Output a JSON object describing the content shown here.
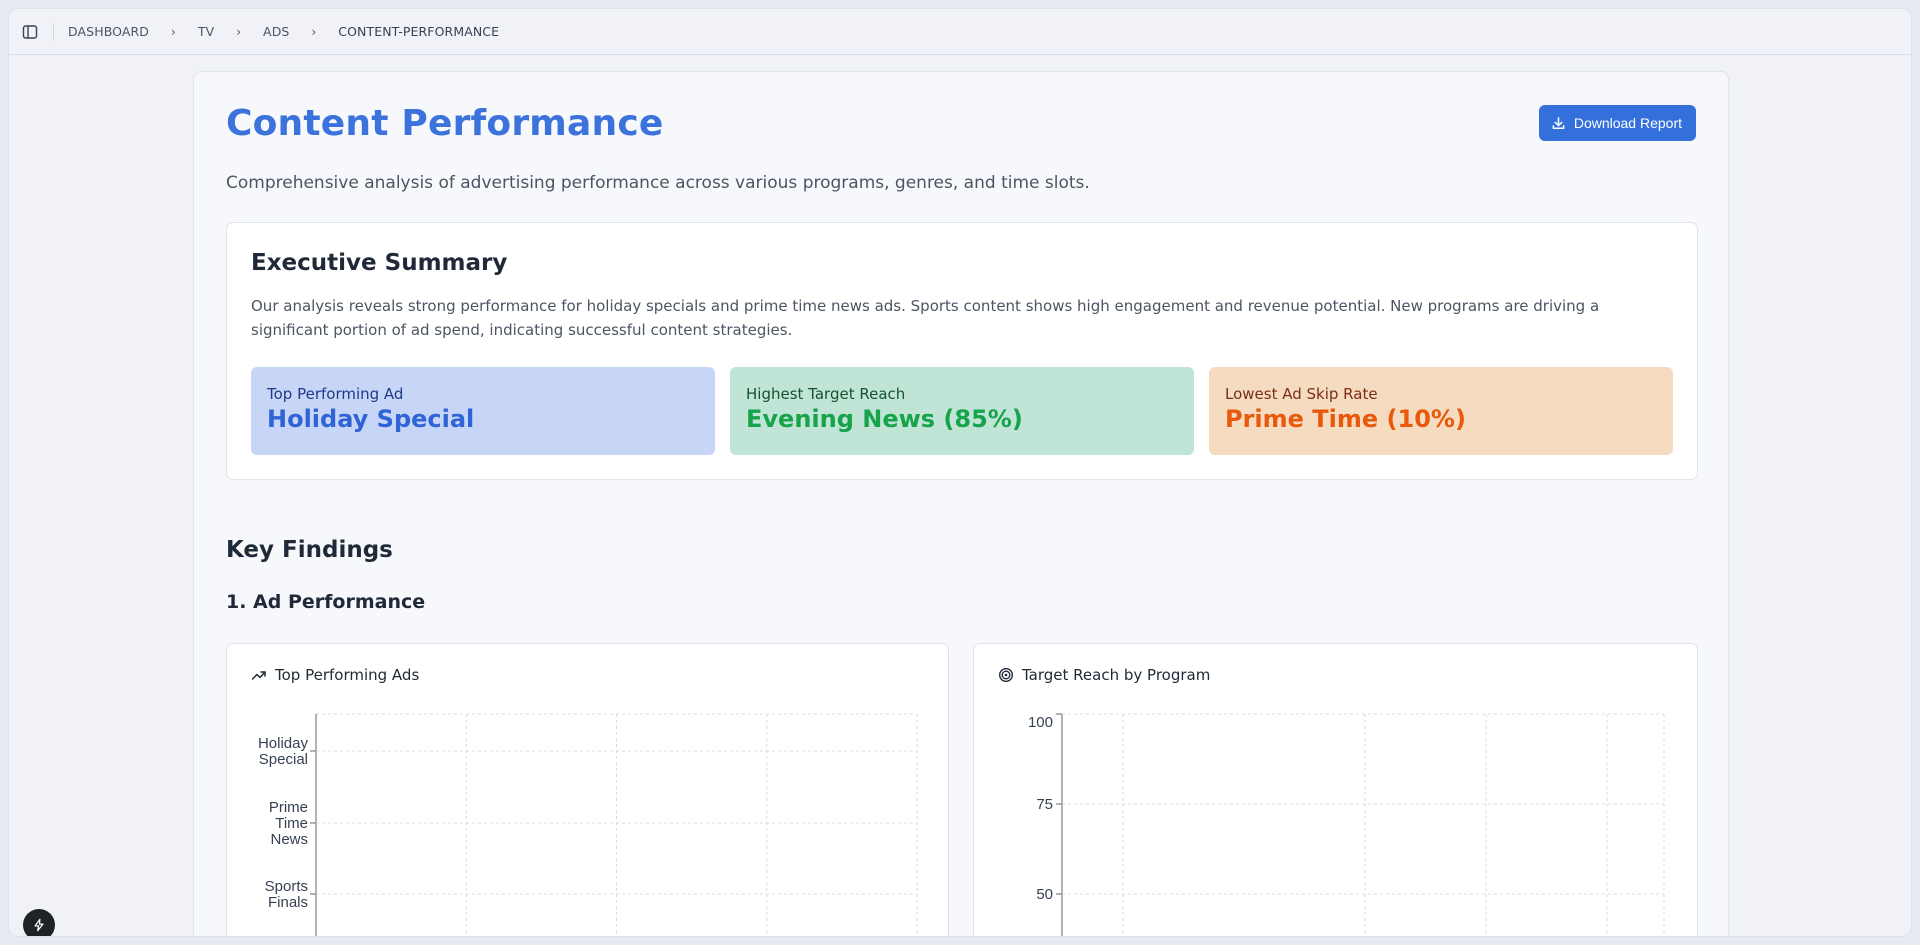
{
  "breadcrumb": [
    "DASHBOARD",
    "TV",
    "ADS",
    "CONTENT-PERFORMANCE"
  ],
  "header": {
    "title": "Content Performance",
    "download_label": "Download Report",
    "subtitle": "Comprehensive analysis of advertising performance across various programs, genres, and time slots."
  },
  "summary": {
    "title": "Executive Summary",
    "text": "Our analysis reveals strong performance for holiday specials and prime time news ads. Sports content shows high engagement and revenue potential. New programs are driving a significant portion of ad spend, indicating successful content strategies.",
    "stats": [
      {
        "label": "Top Performing Ad",
        "value": "Holiday Special"
      },
      {
        "label": "Highest Target Reach",
        "value": "Evening News (85%)"
      },
      {
        "label": "Lowest Ad Skip Rate",
        "value": "Prime Time (10%)"
      }
    ]
  },
  "findings": {
    "title": "Key Findings",
    "section1": "1. Ad Performance"
  },
  "chart_data": [
    {
      "type": "bar",
      "title": "Top Performing Ads",
      "orientation": "horizontal",
      "categories": [
        "Holiday Special",
        "Prime Time News",
        "Sports Finals"
      ],
      "values": [],
      "grid": true
    },
    {
      "type": "bar",
      "title": "Target Reach by Program",
      "ytick_labels": [
        "100",
        "75",
        "50"
      ],
      "ylim": [
        0,
        100
      ],
      "values": [],
      "grid": true
    }
  ],
  "colors": {
    "accent": "#3470dc",
    "title": "#3b72db"
  }
}
